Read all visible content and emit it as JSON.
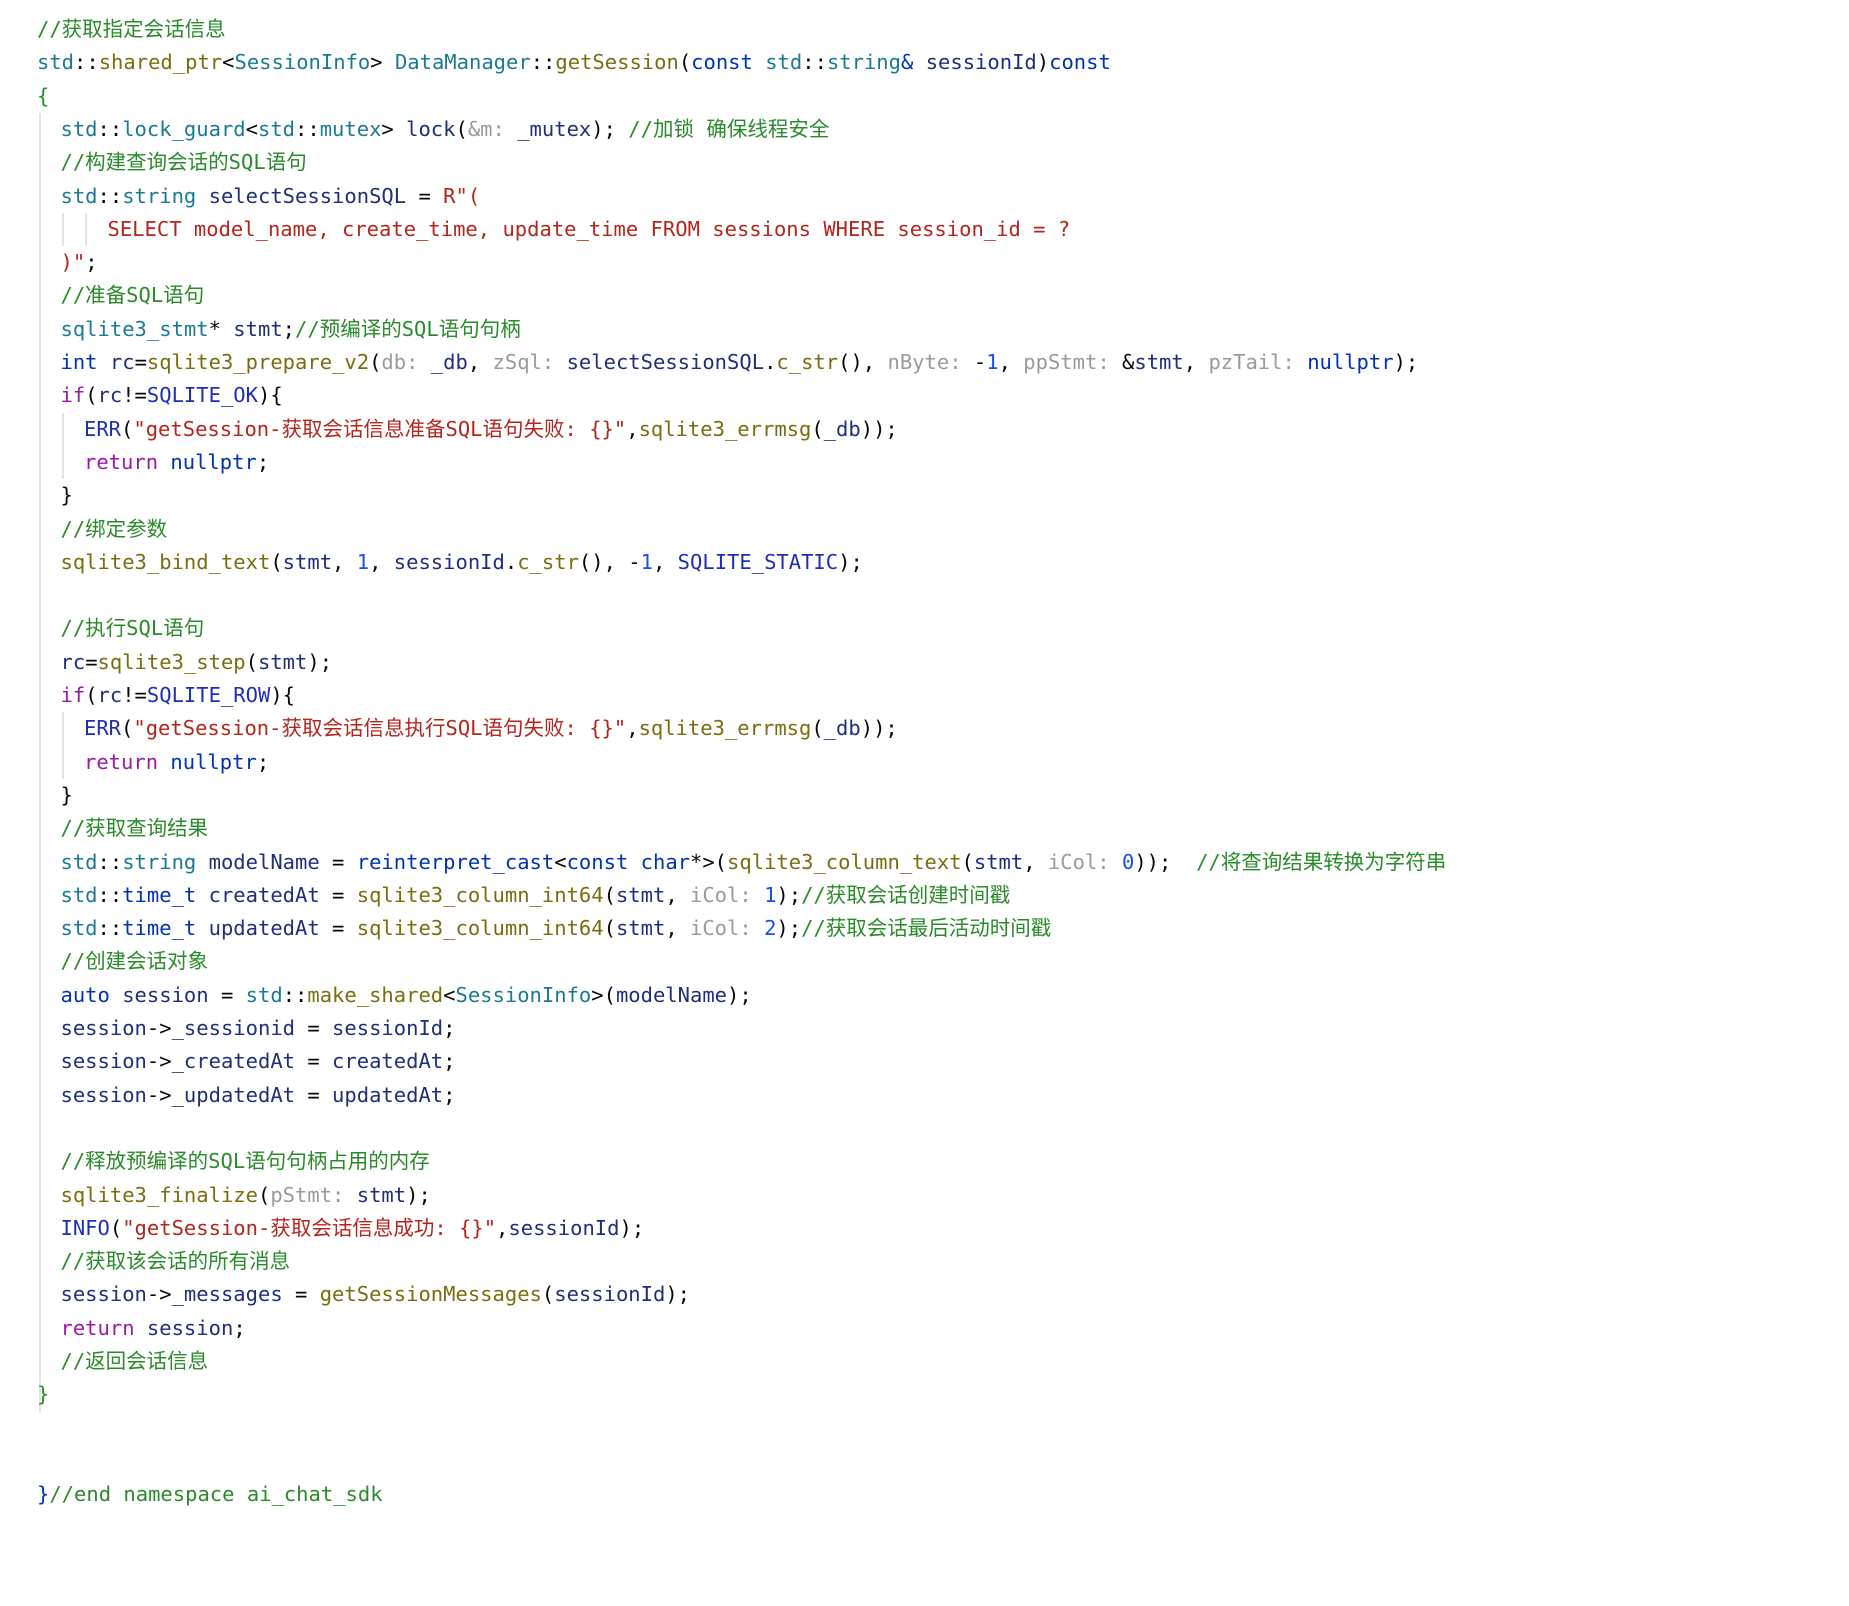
{
  "editor": {
    "language": "cpp",
    "lines": [
      {
        "indent": 0,
        "tokens": [
          [
            "c",
            "//获取指定会话信息"
          ]
        ]
      },
      {
        "indent": 0,
        "tokens": [
          [
            "ns",
            "std"
          ],
          [
            "pn",
            "::"
          ],
          [
            "fn",
            "shared_ptr"
          ],
          [
            "pn",
            "<"
          ],
          [
            "ty",
            "SessionInfo"
          ],
          [
            "pn",
            "> "
          ],
          [
            "ty",
            "DataManager"
          ],
          [
            "pn",
            "::"
          ],
          [
            "fn",
            "getSession"
          ],
          [
            "pn",
            "("
          ],
          [
            "kw",
            "const "
          ],
          [
            "ns",
            "std"
          ],
          [
            "pn",
            "::"
          ],
          [
            "ty",
            "string"
          ],
          [
            "kw",
            "& "
          ],
          [
            "id",
            "sessionId"
          ],
          [
            "pn",
            ")"
          ],
          [
            "kw",
            "const"
          ]
        ]
      },
      {
        "indent": 0,
        "tokens": [
          [
            "c",
            "{"
          ]
        ]
      },
      {
        "indent": 1,
        "tokens": [
          [
            "ns",
            "std"
          ],
          [
            "pn",
            "::"
          ],
          [
            "ty",
            "lock_guard"
          ],
          [
            "pn",
            "<"
          ],
          [
            "ns",
            "std"
          ],
          [
            "pn",
            "::"
          ],
          [
            "ty",
            "mutex"
          ],
          [
            "pn",
            "> "
          ],
          [
            "id",
            "lock"
          ],
          [
            "pn",
            "("
          ],
          [
            "hn",
            "&m: "
          ],
          [
            "id",
            "_mutex"
          ],
          [
            "pn",
            "); "
          ],
          [
            "c",
            "//加锁 确保线程安全"
          ]
        ]
      },
      {
        "indent": 1,
        "tokens": [
          [
            "c",
            "//构建查询会话的SQL语句"
          ]
        ]
      },
      {
        "indent": 1,
        "tokens": [
          [
            "ns",
            "std"
          ],
          [
            "pn",
            "::"
          ],
          [
            "ty",
            "string "
          ],
          [
            "id",
            "selectSessionSQL"
          ],
          [
            "pn",
            " = "
          ],
          [
            "st",
            "R\"("
          ]
        ]
      },
      {
        "indent": 3,
        "tokens": [
          [
            "st",
            "SELECT model_name, create_time, update_time FROM sessions WHERE session_id = ?"
          ]
        ]
      },
      {
        "indent": 1,
        "tokens": [
          [
            "st",
            ")\""
          ],
          [
            "pn",
            ";"
          ]
        ]
      },
      {
        "indent": 1,
        "tokens": [
          [
            "c",
            "//准备SQL语句"
          ]
        ]
      },
      {
        "indent": 1,
        "tokens": [
          [
            "ty",
            "sqlite3_stmt"
          ],
          [
            "pn",
            "* "
          ],
          [
            "id",
            "stmt"
          ],
          [
            "pn",
            ";"
          ],
          [
            "c",
            "//预编译的SQL语句句柄"
          ]
        ]
      },
      {
        "indent": 1,
        "tokens": [
          [
            "kw",
            "int "
          ],
          [
            "id",
            "rc"
          ],
          [
            "pn",
            "="
          ],
          [
            "fn",
            "sqlite3_prepare_v2"
          ],
          [
            "pn",
            "("
          ],
          [
            "hn",
            "db: "
          ],
          [
            "id",
            "_db"
          ],
          [
            "pn",
            ", "
          ],
          [
            "hn",
            "zSql: "
          ],
          [
            "id",
            "selectSessionSQL"
          ],
          [
            "pn",
            "."
          ],
          [
            "fn",
            "c_str"
          ],
          [
            "pn",
            "(), "
          ],
          [
            "hn",
            "nByte: "
          ],
          [
            "pn",
            "-"
          ],
          [
            "nm",
            "1"
          ],
          [
            "pn",
            ", "
          ],
          [
            "hn",
            "ppStmt: "
          ],
          [
            "pn",
            "&"
          ],
          [
            "id",
            "stmt"
          ],
          [
            "pn",
            ", "
          ],
          [
            "hn",
            "pzTail: "
          ],
          [
            "kw",
            "nullptr"
          ],
          [
            "pn",
            ");"
          ]
        ]
      },
      {
        "indent": 1,
        "tokens": [
          [
            "ctl",
            "if"
          ],
          [
            "pn",
            "("
          ],
          [
            "id",
            "rc"
          ],
          [
            "pn",
            "!="
          ],
          [
            "mc",
            "SQLITE_OK"
          ],
          [
            "pn",
            "){"
          ]
        ]
      },
      {
        "indent": 2,
        "tokens": [
          [
            "mc",
            "ERR"
          ],
          [
            "pn",
            "("
          ],
          [
            "st",
            "\"getSession-获取会话信息准备SQL语句失败: {}\""
          ],
          [
            "pn",
            ","
          ],
          [
            "fn",
            "sqlite3_errmsg"
          ],
          [
            "pn",
            "("
          ],
          [
            "id",
            "_db"
          ],
          [
            "pn",
            "));"
          ]
        ]
      },
      {
        "indent": 2,
        "tokens": [
          [
            "ctl",
            "return "
          ],
          [
            "kw",
            "nullptr"
          ],
          [
            "pn",
            ";"
          ]
        ]
      },
      {
        "indent": 1,
        "tokens": [
          [
            "pn",
            "}"
          ]
        ]
      },
      {
        "indent": 1,
        "tokens": [
          [
            "c",
            "//绑定参数"
          ]
        ]
      },
      {
        "indent": 1,
        "tokens": [
          [
            "fn",
            "sqlite3_bind_text"
          ],
          [
            "pn",
            "("
          ],
          [
            "id",
            "stmt"
          ],
          [
            "pn",
            ", "
          ],
          [
            "nm",
            "1"
          ],
          [
            "pn",
            ", "
          ],
          [
            "id",
            "sessionId"
          ],
          [
            "pn",
            "."
          ],
          [
            "fn",
            "c_str"
          ],
          [
            "pn",
            "(), -"
          ],
          [
            "nm",
            "1"
          ],
          [
            "pn",
            ", "
          ],
          [
            "mc",
            "SQLITE_STATIC"
          ],
          [
            "pn",
            ");"
          ]
        ]
      },
      {
        "indent": 1,
        "tokens": []
      },
      {
        "indent": 1,
        "tokens": [
          [
            "c",
            "//执行SQL语句"
          ]
        ]
      },
      {
        "indent": 1,
        "tokens": [
          [
            "id",
            "rc"
          ],
          [
            "pn",
            "="
          ],
          [
            "fn",
            "sqlite3_step"
          ],
          [
            "pn",
            "("
          ],
          [
            "id",
            "stmt"
          ],
          [
            "pn",
            ");"
          ]
        ]
      },
      {
        "indent": 1,
        "tokens": [
          [
            "ctl",
            "if"
          ],
          [
            "pn",
            "("
          ],
          [
            "id",
            "rc"
          ],
          [
            "pn",
            "!="
          ],
          [
            "mc",
            "SQLITE_ROW"
          ],
          [
            "pn",
            "){"
          ]
        ]
      },
      {
        "indent": 2,
        "tokens": [
          [
            "mc",
            "ERR"
          ],
          [
            "pn",
            "("
          ],
          [
            "st",
            "\"getSession-获取会话信息执行SQL语句失败: {}\""
          ],
          [
            "pn",
            ","
          ],
          [
            "fn",
            "sqlite3_errmsg"
          ],
          [
            "pn",
            "("
          ],
          [
            "id",
            "_db"
          ],
          [
            "pn",
            "));"
          ]
        ]
      },
      {
        "indent": 2,
        "tokens": [
          [
            "ctl",
            "return "
          ],
          [
            "kw",
            "nullptr"
          ],
          [
            "pn",
            ";"
          ]
        ]
      },
      {
        "indent": 1,
        "tokens": [
          [
            "pn",
            "}"
          ]
        ]
      },
      {
        "indent": 1,
        "tokens": [
          [
            "c",
            "//获取查询结果"
          ]
        ]
      },
      {
        "indent": 1,
        "tokens": [
          [
            "ns",
            "std"
          ],
          [
            "pn",
            "::"
          ],
          [
            "ty",
            "string "
          ],
          [
            "id",
            "modelName"
          ],
          [
            "pn",
            " = "
          ],
          [
            "kw",
            "reinterpret_cast"
          ],
          [
            "pn",
            "<"
          ],
          [
            "kw",
            "const char"
          ],
          [
            "pn",
            "*>("
          ],
          [
            "fn",
            "sqlite3_column_text"
          ],
          [
            "pn",
            "("
          ],
          [
            "id",
            "stmt"
          ],
          [
            "pn",
            ", "
          ],
          [
            "hn",
            "iCol: "
          ],
          [
            "nm",
            "0"
          ],
          [
            "pn",
            "));  "
          ],
          [
            "c",
            "//将查询结果转换为字符串"
          ]
        ]
      },
      {
        "indent": 1,
        "tokens": [
          [
            "ns",
            "std"
          ],
          [
            "pn",
            "::"
          ],
          [
            "kw",
            "time_t "
          ],
          [
            "id",
            "createdAt"
          ],
          [
            "pn",
            " = "
          ],
          [
            "fn",
            "sqlite3_column_int64"
          ],
          [
            "pn",
            "("
          ],
          [
            "id",
            "stmt"
          ],
          [
            "pn",
            ", "
          ],
          [
            "hn",
            "iCol: "
          ],
          [
            "nm",
            "1"
          ],
          [
            "pn",
            ");"
          ],
          [
            "c",
            "//获取会话创建时间戳"
          ]
        ]
      },
      {
        "indent": 1,
        "tokens": [
          [
            "ns",
            "std"
          ],
          [
            "pn",
            "::"
          ],
          [
            "kw",
            "time_t "
          ],
          [
            "id",
            "updatedAt"
          ],
          [
            "pn",
            " = "
          ],
          [
            "fn",
            "sqlite3_column_int64"
          ],
          [
            "pn",
            "("
          ],
          [
            "id",
            "stmt"
          ],
          [
            "pn",
            ", "
          ],
          [
            "hn",
            "iCol: "
          ],
          [
            "nm",
            "2"
          ],
          [
            "pn",
            ");"
          ],
          [
            "c",
            "//获取会话最后活动时间戳"
          ]
        ]
      },
      {
        "indent": 1,
        "tokens": [
          [
            "c",
            "//创建会话对象"
          ]
        ]
      },
      {
        "indent": 1,
        "tokens": [
          [
            "kw",
            "auto "
          ],
          [
            "id",
            "session"
          ],
          [
            "pn",
            " = "
          ],
          [
            "ns",
            "std"
          ],
          [
            "pn",
            "::"
          ],
          [
            "fn",
            "make_shared"
          ],
          [
            "pn",
            "<"
          ],
          [
            "ty",
            "SessionInfo"
          ],
          [
            "pn",
            ">("
          ],
          [
            "id",
            "modelName"
          ],
          [
            "pn",
            ");"
          ]
        ]
      },
      {
        "indent": 1,
        "tokens": [
          [
            "id",
            "session"
          ],
          [
            "pn",
            "->"
          ],
          [
            "id",
            "_sessionid"
          ],
          [
            "pn",
            " = "
          ],
          [
            "id",
            "sessionId"
          ],
          [
            "pn",
            ";"
          ]
        ]
      },
      {
        "indent": 1,
        "tokens": [
          [
            "id",
            "session"
          ],
          [
            "pn",
            "->"
          ],
          [
            "id",
            "_createdAt"
          ],
          [
            "pn",
            " = "
          ],
          [
            "id",
            "createdAt"
          ],
          [
            "pn",
            ";"
          ]
        ]
      },
      {
        "indent": 1,
        "tokens": [
          [
            "id",
            "session"
          ],
          [
            "pn",
            "->"
          ],
          [
            "id",
            "_updatedAt"
          ],
          [
            "pn",
            " = "
          ],
          [
            "id",
            "updatedAt"
          ],
          [
            "pn",
            ";"
          ]
        ]
      },
      {
        "indent": 1,
        "tokens": []
      },
      {
        "indent": 1,
        "tokens": [
          [
            "c",
            "//释放预编译的SQL语句句柄占用的内存"
          ]
        ]
      },
      {
        "indent": 1,
        "tokens": [
          [
            "fn",
            "sqlite3_finalize"
          ],
          [
            "pn",
            "("
          ],
          [
            "hn",
            "pStmt: "
          ],
          [
            "id",
            "stmt"
          ],
          [
            "pn",
            ");"
          ]
        ]
      },
      {
        "indent": 1,
        "tokens": [
          [
            "mc",
            "INFO"
          ],
          [
            "pn",
            "("
          ],
          [
            "st",
            "\"getSession-获取会话信息成功: {}\""
          ],
          [
            "pn",
            ","
          ],
          [
            "id",
            "sessionId"
          ],
          [
            "pn",
            ");"
          ]
        ]
      },
      {
        "indent": 1,
        "tokens": [
          [
            "c",
            "//获取该会话的所有消息"
          ]
        ]
      },
      {
        "indent": 1,
        "tokens": [
          [
            "id",
            "session"
          ],
          [
            "pn",
            "->"
          ],
          [
            "id",
            "_messages"
          ],
          [
            "pn",
            " = "
          ],
          [
            "fn",
            "getSessionMessages"
          ],
          [
            "pn",
            "("
          ],
          [
            "id",
            "sessionId"
          ],
          [
            "pn",
            ");"
          ]
        ]
      },
      {
        "indent": 1,
        "tokens": [
          [
            "ctl",
            "return "
          ],
          [
            "id",
            "session"
          ],
          [
            "pn",
            ";"
          ]
        ]
      },
      {
        "indent": 1,
        "tokens": [
          [
            "c",
            "//返回会话信息"
          ]
        ]
      },
      {
        "indent": 0,
        "tokens": [
          [
            "c",
            "}"
          ]
        ]
      },
      {
        "indent": 0,
        "tokens": []
      },
      {
        "indent": 0,
        "tokens": []
      },
      {
        "indent": 0,
        "tokens": [
          [
            "kw",
            "}"
          ],
          [
            "c",
            "//end namespace ai_chat_sdk"
          ]
        ]
      }
    ]
  }
}
